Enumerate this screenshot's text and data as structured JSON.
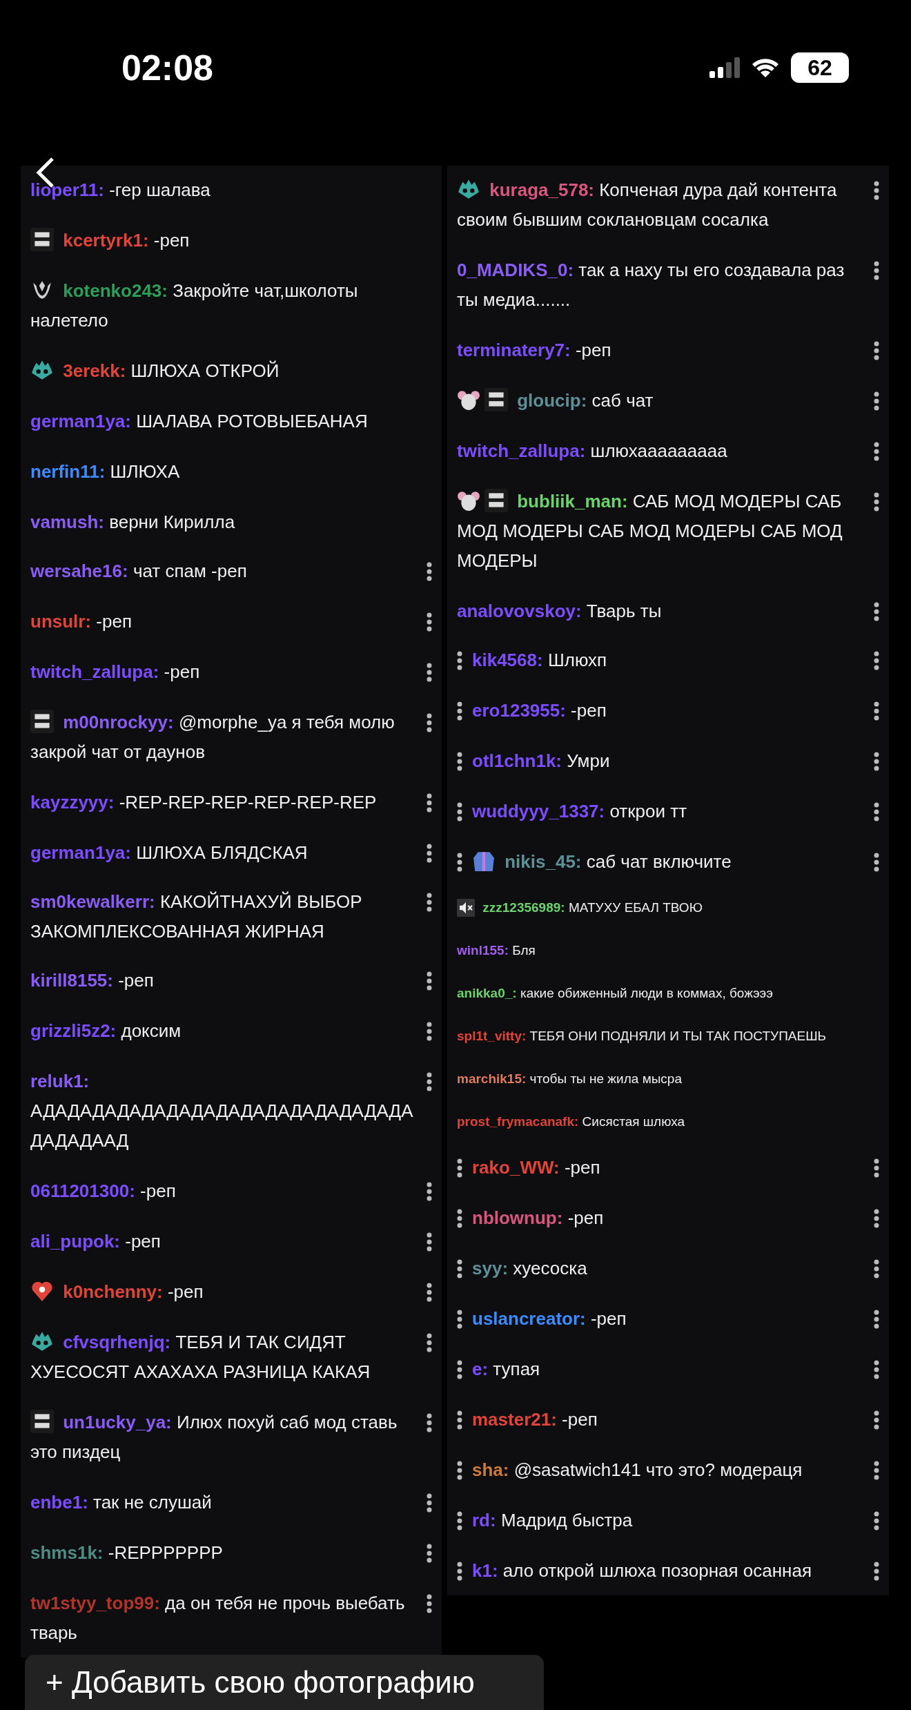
{
  "status_bar": {
    "time": "02:08",
    "battery": "62"
  },
  "columns": [
    {
      "panels": [
        {
          "kind": "normal",
          "menu_left": false,
          "menu_right": false,
          "messages": [
            {
              "user": "lioper11:",
              "color": "#7c4dff",
              "text": "-гер шалава"
            },
            {
              "user": "kcertyrk1:",
              "color": "#e0443a",
              "text": "-реп",
              "badges": [
                {
                  "kind": "tile"
                }
              ]
            },
            {
              "user": "kotenko243:",
              "color": "#2e9d5a",
              "text": "Закройте чат,школоты налетело",
              "badges": [
                {
                  "kind": "wreath"
                }
              ]
            },
            {
              "user": "3erekk:",
              "color": "#e0443a",
              "text": "ШЛЮХА ОТКРОЙ",
              "badges": [
                {
                  "kind": "creature"
                }
              ]
            },
            {
              "user": "german1ya:",
              "color": "#7c4dff",
              "text": "ШАЛАВА РОТОВЫЕБАНАЯ"
            },
            {
              "user": "nerfin11:",
              "color": "#3d8bff",
              "text": "ШЛЮХА"
            },
            {
              "user": "vamush:",
              "color": "#8a5cf6",
              "text": "верни Кирилла"
            }
          ]
        },
        {
          "kind": "normal",
          "menu_left": false,
          "menu_right": true,
          "messages": [
            {
              "user": "wersahe16:",
              "color": "#8a5cf6",
              "text": "чат спам -реп"
            },
            {
              "user": "unsulr:",
              "color": "#e0443a",
              "text": "-реп"
            },
            {
              "user": "twitch_zallupa:",
              "color": "#7c4dff",
              "text": "-реп"
            },
            {
              "user": "m00nrockyy:",
              "color": "#8a5cf6",
              "text": "@morphe_ya я тебя молю закрой чат от даунов",
              "badges": [
                {
                  "kind": "tile"
                }
              ]
            },
            {
              "user": "kayzzyyy:",
              "color": "#7c4dff",
              "text": "-REP-REP-REP-REP-REP-REP"
            },
            {
              "user": "german1ya:",
              "color": "#7c4dff",
              "text": "ШЛЮХА БЛЯДСКАЯ"
            }
          ]
        },
        {
          "kind": "normal",
          "menu_left": false,
          "menu_right": true,
          "messages": [
            {
              "user": "sm0kewalkerr:",
              "color": "#8a5cf6",
              "text": "КАКОЙТНАХУЙ ВЫБОР ЗАКОМПЛЕКСОВАННАЯ ЖИРНАЯ"
            }
          ]
        },
        {
          "kind": "normal",
          "menu_left": false,
          "menu_right": true,
          "messages": [
            {
              "user": "kirill8155:",
              "color": "#8a5cf6",
              "text": "-реп"
            },
            {
              "user": "grizzli5z2:",
              "color": "#7c4dff",
              "text": "доксим"
            },
            {
              "user": "reluk1:",
              "color": "#8a5cf6",
              "text": "АДАДАДАДАДАДАДАДАДАДАДАДАДАДАДАДАДАДААД"
            },
            {
              "user": "0611201300:",
              "color": "#7c4dff",
              "text": "-реп"
            },
            {
              "user": "ali_pupok:",
              "color": "#7c4dff",
              "text": "-реп"
            },
            {
              "user": "k0nchenny:",
              "color": "#e0443a",
              "text": "-реп",
              "badges": [
                {
                  "kind": "heart"
                }
              ]
            },
            {
              "user": "cfvsqrhenjq:",
              "color": "#7c4dff",
              "text": "ТЕБЯ И ТАК СИДЯТ ХУЕСОСЯТ АХАХАХА РАЗНИЦА КАКАЯ",
              "badges": [
                {
                  "kind": "creature"
                }
              ]
            },
            {
              "user": "un1ucky_ya:",
              "color": "#8a5cf6",
              "text": "Илюх похуй саб мод ставь это пиздец",
              "badges": [
                {
                  "kind": "tile"
                }
              ]
            },
            {
              "user": "enbe1:",
              "color": "#7c4dff",
              "text": "так не слушай"
            },
            {
              "user": "shms1k:",
              "color": "#4f8a84",
              "text": "-REPPPPPPP"
            },
            {
              "user": "tw1styy_top99:",
              "color": "#b0342c",
              "text": "да он тебя не прочь выебать тварь"
            }
          ]
        }
      ]
    },
    {
      "panels": [
        {
          "kind": "normal",
          "menu_left": false,
          "menu_right": true,
          "messages": [
            {
              "user": "kuraga_578:",
              "color": "#d9577f",
              "text": "Копченая дура дай контента своим бывшим сокланoвцам сосалка",
              "badges": [
                {
                  "kind": "creature"
                }
              ]
            },
            {
              "user": "0_MADIKS_0:",
              "color": "#8a5cf6",
              "text": "так а наху ты его создавала раз ты медиа......."
            },
            {
              "user": "terminatery7:",
              "color": "#7c4dff",
              "text": "-реп"
            },
            {
              "user": "gloucip:",
              "color": "#5f8f96",
              "text": "саб чат",
              "badges": [
                {
                  "kind": "mouse"
                },
                {
                  "kind": "tile"
                }
              ]
            },
            {
              "user": "twitch_zallupa:",
              "color": "#7c4dff",
              "text": "шлюхааааааааа"
            },
            {
              "user": "bubliik_man:",
              "color": "#6bd36b",
              "text": "САБ МОД МОДЕРЫ САБ МОД МОДЕРЫ САБ МОД МОДЕРЫ САБ МОД МОДЕРЫ",
              "badges": [
                {
                  "kind": "mouse"
                },
                {
                  "kind": "tile"
                }
              ]
            },
            {
              "user": "analovovskoy:",
              "color": "#7c4dff",
              "text": "Тварь ты"
            }
          ]
        },
        {
          "kind": "normal",
          "menu_left": true,
          "menu_right": true,
          "messages": [
            {
              "user": "kik4568:",
              "color": "#7c4dff",
              "text": "Шлюхп"
            },
            {
              "user": "ero123955:",
              "color": "#7c4dff",
              "text": "-реп"
            },
            {
              "user": "otl1chn1k:",
              "color": "#7c4dff",
              "text": "Умри"
            },
            {
              "user": "wuddyyy_1337:",
              "color": "#7c4dff",
              "text": "открои тт"
            },
            {
              "user": "nikis_45:",
              "color": "#5f8f96",
              "text": "саб чат включите",
              "badges": [
                {
                  "kind": "jacket"
                }
              ]
            }
          ]
        },
        {
          "kind": "compact",
          "menu_left": false,
          "menu_right": false,
          "messages": [
            {
              "user": "zzz12356989:",
              "color": "#6bd36b",
              "text": "МАТУХУ ЕБАЛ ТВОЮ",
              "badges": [
                {
                  "kind": "muted"
                }
              ]
            },
            {
              "user": "winl155:",
              "color": "#a15cf0",
              "text": "Бля"
            },
            {
              "user": "anikka0_:",
              "color": "#6bd36b",
              "text": "какие обиженный люди в коммах, божэээ"
            },
            {
              "user": "spl1t_vitty:",
              "color": "#e0443a",
              "text": "ТЕБЯ ОНИ ПОДНЯЛИ И ТЫ ТАК ПОСТУПАЕШЬ"
            },
            {
              "user": "marchik15:",
              "color": "#e07a5a",
              "text": "чтобы ты не жила мысра"
            },
            {
              "user": "prost_frymacanafk:",
              "color": "#e0443a",
              "text": "Сисястая шлюха"
            }
          ]
        },
        {
          "kind": "normal",
          "menu_left": true,
          "menu_right": true,
          "messages": [
            {
              "user": "rako_WW:",
              "color": "#e0443a",
              "text": "-реп"
            },
            {
              "user": "nblownup:",
              "color": "#d9577f",
              "text": "-реп"
            },
            {
              "user": "syy:",
              "color": "#5f8f96",
              "text": "хуесоска"
            },
            {
              "user": "uslancreator:",
              "color": "#3d8bff",
              "text": "-реп"
            },
            {
              "user": "e:",
              "color": "#7c4dff",
              "text": "тупая"
            },
            {
              "user": "master21:",
              "color": "#e0443a",
              "text": "-реп"
            },
            {
              "user": "sha:",
              "color": "#c97a3c",
              "text": "@sasatwich141 что это? модераця"
            },
            {
              "user": "rd:",
              "color": "#7c4dff",
              "text": "Мадрид быстра"
            },
            {
              "user": "k1:",
              "color": "#7c4dff",
              "text": "ало открой шлюха позорная осанная"
            }
          ]
        }
      ]
    }
  ],
  "add_photo_button": {
    "label": "+ Добавить свою фотографию"
  }
}
